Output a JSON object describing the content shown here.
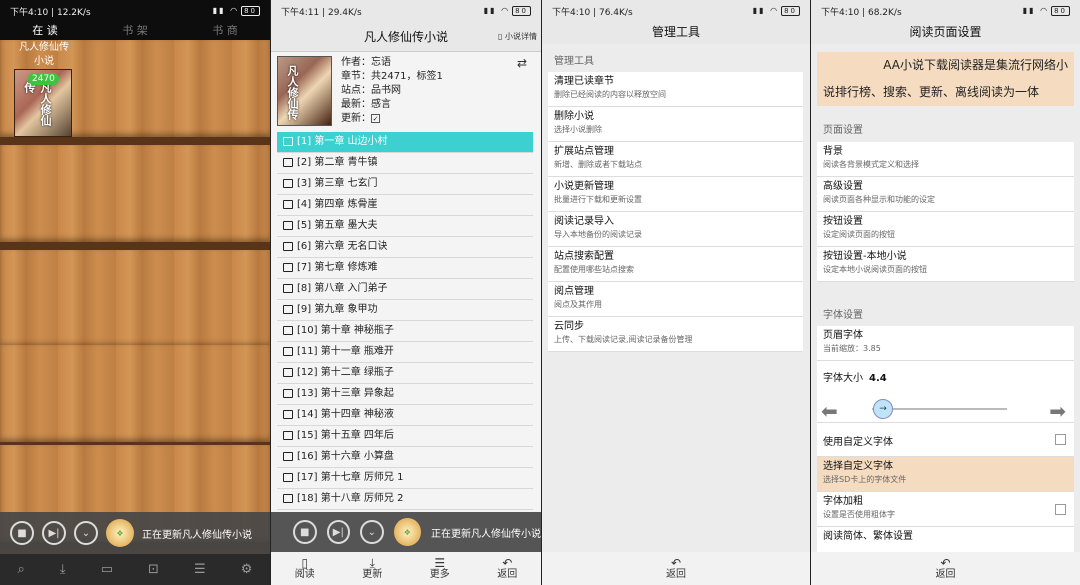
{
  "panel1": {
    "status": {
      "time": "下午4:10 | 12.2K/s",
      "battery": "80"
    },
    "tabs": [
      "在 读",
      "书 架",
      "书 商"
    ],
    "book": {
      "title": "凡人修仙传",
      "subtitle": "小说",
      "count": "2470",
      "cover_text": "凡人修仙传"
    },
    "updating": "正在更新凡人修仙传小说"
  },
  "panel2": {
    "status": {
      "time": "下午4:11 | 29.4K/s",
      "battery": "80"
    },
    "title": "凡人修仙传小说",
    "detail_label": "小说详情",
    "cover_text": "凡人修仙传",
    "meta": [
      "作者：忘语",
      "章节：共2471，标签1",
      "站点：品书网",
      "最新：感言",
      "更新："
    ],
    "chapters": [
      "[1]  第一章 山边小村",
      "[2]  第二章 青牛镇",
      "[3]  第三章 七玄门",
      "[4]  第四章 炼骨崖",
      "[5]  第五章 墨大夫",
      "[6]  第六章 无名口诀",
      "[7]  第七章 修炼难",
      "[8]  第八章 入门弟子",
      "[9]  第九章 象甲功",
      "[10]  第十章 神秘瓶子",
      "[11]  第十一章 瓶难开",
      "[12]  第十二章 绿瓶子",
      "[13]  第十三章 异象起",
      "[14]  第十四章 神秘液",
      "[15]  第十五章 四年后",
      "[16]  第十六章 小算盘",
      "[17]  第十七章 厉师兄 1",
      "[18]  第十八章 厉师兄 2"
    ],
    "updating": "正在更新凡人修仙传小说",
    "nav": [
      "阅读",
      "更新",
      "更多",
      "返回"
    ]
  },
  "panel3": {
    "status": {
      "time": "下午4:10 | 76.4K/s",
      "battery": "80"
    },
    "title": "管理工具",
    "section": "管理工具",
    "items": [
      {
        "title": "清理已读章节",
        "desc": "删除已经阅读的内容以释放空间"
      },
      {
        "title": "删除小说",
        "desc": "选择小说删除"
      },
      {
        "title": "扩展站点管理",
        "desc": "新增、删除或者下载站点"
      },
      {
        "title": "小说更新管理",
        "desc": "批量进行下载和更新设置"
      },
      {
        "title": "阅读记录导入",
        "desc": "导入本地备份的阅读记录"
      },
      {
        "title": "站点搜索配置",
        "desc": "配置使用哪些站点搜索"
      },
      {
        "title": "阅点管理",
        "desc": "阅点及其作用"
      },
      {
        "title": "云同步",
        "desc": "上传、下载阅读记录,阅读记录备份管理"
      }
    ],
    "back": "返回"
  },
  "panel4": {
    "status": {
      "time": "下午4:10 | 68.2K/s",
      "battery": "80"
    },
    "title": "阅读页面设置",
    "ad_line1": "AA小说下载阅读器是集流行网络小",
    "ad_line2": "说排行榜、搜索、更新、离线阅读为一体",
    "section1": "页面设置",
    "page_items": [
      {
        "title": "背景",
        "desc": "阅读各背景模式定义和选择"
      },
      {
        "title": "高级设置",
        "desc": "阅读页面各种显示和功能的设定"
      },
      {
        "title": "按钮设置",
        "desc": "设定阅读页面的按钮"
      },
      {
        "title": "按钮设置-本地小说",
        "desc": "设定本地小说阅读页面的按钮"
      }
    ],
    "section2": "字体设置",
    "footer_font": {
      "title": "页眉字体",
      "desc": "当前缩放：3.85"
    },
    "font_size_label": "字体大小",
    "font_size_value": "4.4",
    "custom_font": "使用自定义字体",
    "choose_font": {
      "title": "选择自定义字体",
      "desc": "选择SD卡上的字体文件"
    },
    "bold": {
      "title": "字体加粗",
      "desc": "设置是否使用粗体字"
    },
    "simp_trad": "阅读简体、繁体设置",
    "back": "返回",
    "highlight_color": "#f5dcc0"
  }
}
